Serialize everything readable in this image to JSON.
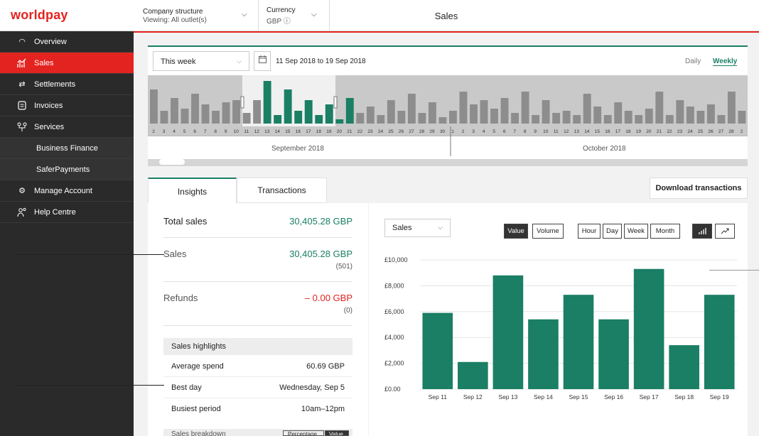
{
  "brand": {
    "logo": "worldpay",
    "accent": "#e3231f",
    "green": "#1a7f64"
  },
  "header": {
    "company_label": "Company structure",
    "company_value": "Viewing: All outlet(s)",
    "currency_label": "Currency",
    "currency_value": "GBP ⓘ",
    "title": "Sales"
  },
  "sidebar": {
    "items": [
      {
        "label": "Overview",
        "icon": "gauge-icon"
      },
      {
        "label": "Sales",
        "icon": "sales-chart-icon"
      },
      {
        "label": "Settlements",
        "icon": "swap-arrows-icon"
      },
      {
        "label": "Invoices",
        "icon": "document-icon"
      },
      {
        "label": "Services",
        "icon": "services-icon"
      },
      {
        "label": "Business Finance"
      },
      {
        "label": "SaferPayments"
      },
      {
        "label": "Manage Account",
        "icon": "gear-icon"
      },
      {
        "label": "Help Centre",
        "icon": "people-icon"
      }
    ]
  },
  "datebar": {
    "period": "This week",
    "range": "11 Sep 2018 to 19 Sep 2018",
    "daily": "Daily",
    "weekly": "Weekly",
    "month1": "September 2018",
    "month2": "October 2018"
  },
  "tabs": {
    "insights": "Insights",
    "transactions": "Transactions",
    "download": "Download transactions"
  },
  "insights": {
    "total_label": "Total sales",
    "total_value": "30,405.28 GBP",
    "sales_label": "Sales",
    "sales_value": "30,405.28 GBP",
    "sales_count": "(501)",
    "refunds_label": "Refunds",
    "refunds_value": "– 0.00 GBP",
    "refunds_count": "(0)",
    "highlights_title": "Sales highlights",
    "avg_label": "Average spend",
    "avg_value": "60.69 GBP",
    "best_label": "Best day",
    "best_value": "Wednesday, Sep 5",
    "busy_label": "Busiest period",
    "busy_value": "10am–12pm",
    "breakdown_title": "Sales breakdown",
    "toggle_pct": "Percentage",
    "toggle_val": "Value"
  },
  "chart_controls": {
    "metric": "Sales",
    "value": "Value",
    "volume": "Volume",
    "hour": "Hour",
    "day": "Day",
    "week": "Week",
    "month": "Month"
  },
  "chart_data": {
    "type": "bar",
    "categories": [
      "Sep 11",
      "Sep 12",
      "Sep 13",
      "Sep 14",
      "Sep 15",
      "Sep 16",
      "Sep 17",
      "Sep 18",
      "Sep 19"
    ],
    "values": [
      5900,
      2100,
      8800,
      5400,
      7300,
      5400,
      9300,
      3400,
      7300
    ],
    "yticks": [
      "£10,000",
      "£8,000",
      "£6,000",
      "£4,000",
      "£2,000",
      "£0.00"
    ],
    "ylim": [
      0,
      10000
    ],
    "color": "#1a7f64"
  },
  "mini_chart": {
    "day_labels": [
      "2",
      "3",
      "4",
      "5",
      "6",
      "7",
      "8",
      "9",
      "10",
      "11",
      "12",
      "13",
      "14",
      "15",
      "16",
      "17",
      "18",
      "19",
      "20",
      "21",
      "22",
      "23",
      "24",
      "25",
      "26",
      "27",
      "28",
      "29",
      "30",
      "1",
      "2",
      "3",
      "4",
      "5",
      "6",
      "7",
      "8",
      "9",
      "10",
      "11",
      "12",
      "13",
      "14",
      "15",
      "16",
      "17",
      "18",
      "19",
      "20",
      "21",
      "22",
      "23",
      "24",
      "25",
      "26",
      "27",
      "28",
      "2"
    ],
    "values": [
      0.8,
      0.3,
      0.6,
      0.35,
      0.7,
      0.45,
      0.3,
      0.5,
      0.55,
      0.25,
      0.55,
      1.0,
      0.2,
      0.8,
      0.3,
      0.55,
      0.2,
      0.45,
      0.1,
      0.6,
      0.25,
      0.4,
      0.2,
      0.55,
      0.3,
      0.7,
      0.25,
      0.5,
      0.15,
      0.3,
      0.75,
      0.45,
      0.55,
      0.35,
      0.6,
      0.25,
      0.75,
      0.2,
      0.55,
      0.25,
      0.3,
      0.2,
      0.7,
      0.4,
      0.2,
      0.5,
      0.3,
      0.2,
      0.35,
      0.75,
      0.2,
      0.55,
      0.4,
      0.3,
      0.45,
      0.2,
      0.75,
      0.3
    ],
    "selected_start": 11,
    "selected_end": 19
  }
}
